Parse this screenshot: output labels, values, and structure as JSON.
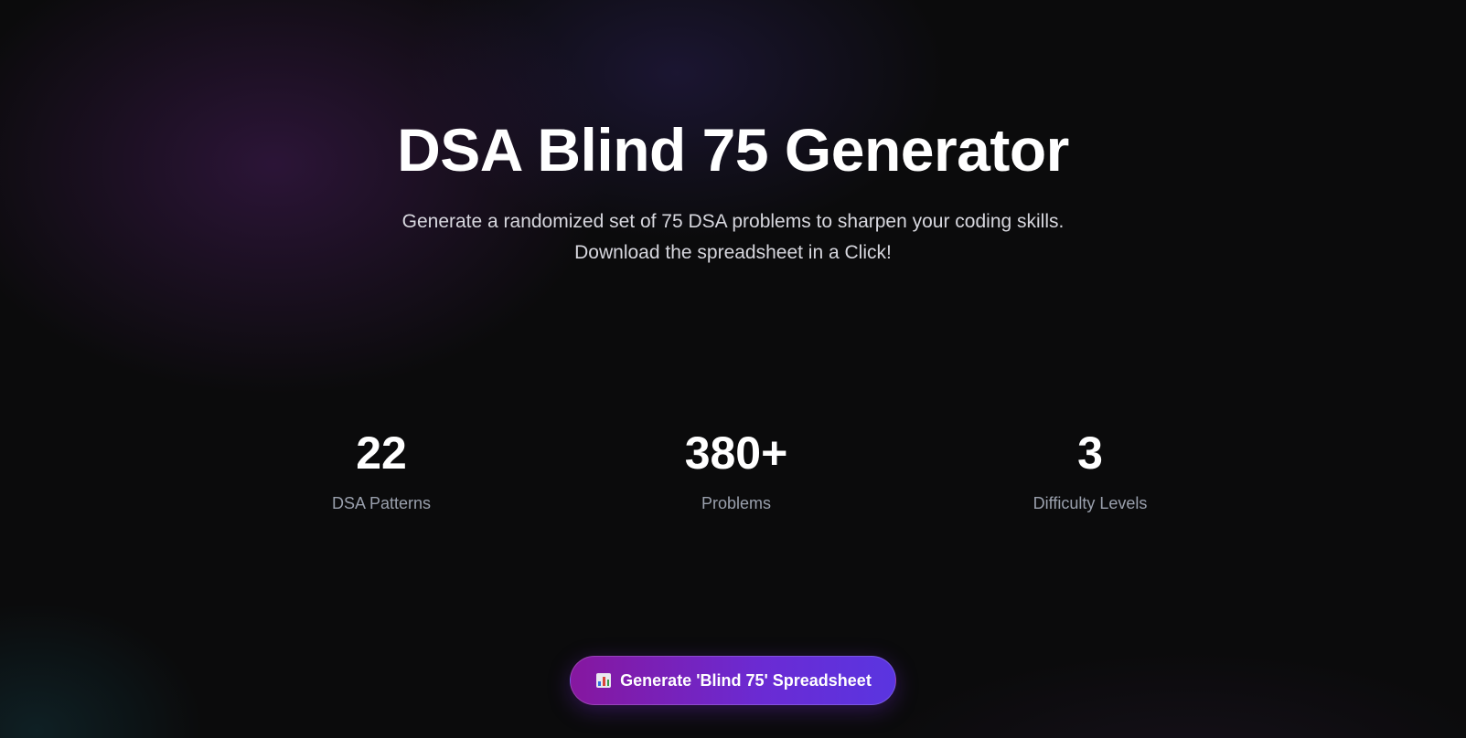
{
  "hero": {
    "title": "DSA Blind 75 Generator",
    "subtitle_line1": "Generate a randomized set of 75 DSA problems to sharpen your coding skills.",
    "subtitle_line2": "Download the spreadsheet in a Click!"
  },
  "stats": [
    {
      "value": "22",
      "label": "DSA Patterns"
    },
    {
      "value": "380+",
      "label": "Problems"
    },
    {
      "value": "3",
      "label": "Difficulty Levels"
    }
  ],
  "cta": {
    "icon": "bar-chart-icon",
    "label": "Generate 'Blind 75' Spreadsheet"
  },
  "colors": {
    "background": "#0b0b0c",
    "cta_gradient_start": "#86179f",
    "cta_gradient_end": "#5a35e0",
    "stat_label": "#9aa0ad"
  }
}
